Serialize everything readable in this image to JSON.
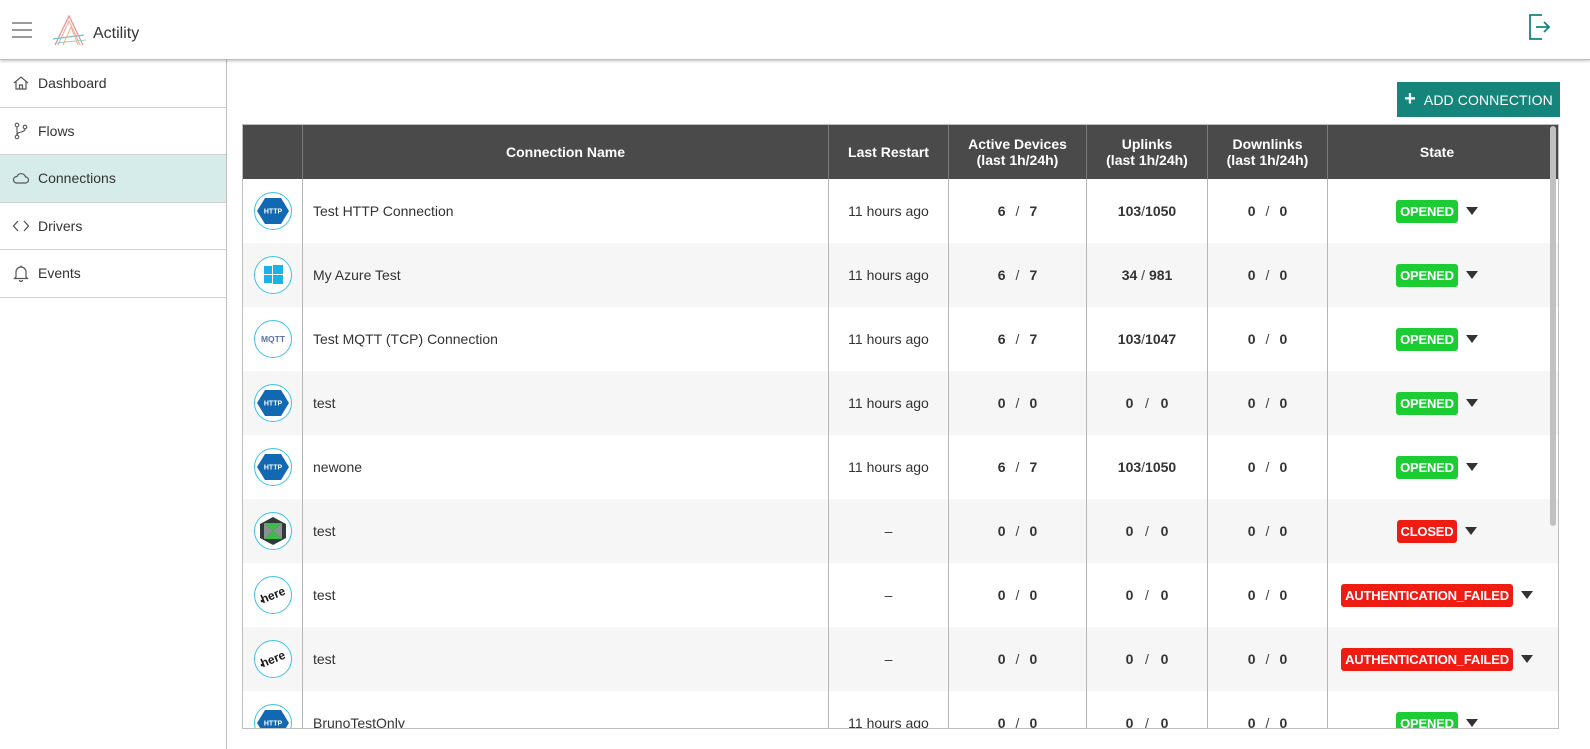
{
  "app": {
    "brand": "Actility"
  },
  "sidebar": {
    "items": [
      {
        "label": "Dashboard",
        "icon": "home-icon",
        "active": false
      },
      {
        "label": "Flows",
        "icon": "branch-icon",
        "active": false
      },
      {
        "label": "Connections",
        "icon": "cloud-icon",
        "active": true
      },
      {
        "label": "Drivers",
        "icon": "code-icon",
        "active": false
      },
      {
        "label": "Events",
        "icon": "bell-icon",
        "active": false
      }
    ]
  },
  "toolbar": {
    "add_label": "ADD CONNECTION"
  },
  "table": {
    "headers": {
      "name": "Connection Name",
      "restart": "Last Restart",
      "active_1": "Active Devices",
      "active_2": "(last 1h/24h)",
      "uplinks_1": "Uplinks",
      "uplinks_2": "(last 1h/24h)",
      "downlinks_1": "Downlinks",
      "downlinks_2": "(last 1h/24h)",
      "state": "State"
    },
    "rows": [
      {
        "icon": "http-icon",
        "name": "Test HTTP Connection",
        "restart": "11 hours ago",
        "active_1h": "6",
        "active_24h": "7",
        "up_1h": "103",
        "up_24h": "1050",
        "up_sep": "/",
        "down_1h": "0",
        "down_24h": "0",
        "state": "OPENED",
        "state_color": "#1bcd33"
      },
      {
        "icon": "windows-icon",
        "name": "My Azure Test",
        "restart": "11 hours ago",
        "active_1h": "6",
        "active_24h": "7",
        "up_1h": "34",
        "up_24h": "981",
        "up_sep": " / ",
        "down_1h": "0",
        "down_24h": "0",
        "state": "OPENED",
        "state_color": "#1bcd33"
      },
      {
        "icon": "mqtt-icon",
        "name": "Test MQTT (TCP) Connection",
        "restart": "11 hours ago",
        "active_1h": "6",
        "active_24h": "7",
        "up_1h": "103",
        "up_24h": "1047",
        "up_sep": "/",
        "down_1h": "0",
        "down_24h": "0",
        "state": "OPENED",
        "state_color": "#1bcd33"
      },
      {
        "icon": "http-icon",
        "name": "test",
        "restart": "11 hours ago",
        "active_1h": "0",
        "active_24h": "0",
        "up_1h": "0",
        "up_24h": "0",
        "up_sep": "   /   ",
        "down_1h": "0",
        "down_24h": "0",
        "state": "OPENED",
        "state_color": "#1bcd33"
      },
      {
        "icon": "http-icon",
        "name": "newone",
        "restart": "11 hours ago",
        "active_1h": "6",
        "active_24h": "7",
        "up_1h": "103",
        "up_24h": "1050",
        "up_sep": "/",
        "down_1h": "0",
        "down_24h": "0",
        "state": "OPENED",
        "state_color": "#1bcd33"
      },
      {
        "icon": "cross-cube-icon",
        "name": "test",
        "restart": "–",
        "active_1h": "0",
        "active_24h": "0",
        "up_1h": "0",
        "up_24h": "0",
        "up_sep": "   /   ",
        "down_1h": "0",
        "down_24h": "0",
        "state": "CLOSED",
        "state_color": "#ee1c12"
      },
      {
        "icon": "here-icon",
        "name": "test",
        "restart": "–",
        "active_1h": "0",
        "active_24h": "0",
        "up_1h": "0",
        "up_24h": "0",
        "up_sep": "   /   ",
        "down_1h": "0",
        "down_24h": "0",
        "state": "AUTHENTICATION_FAILED",
        "state_color": "#ee1c12"
      },
      {
        "icon": "here-icon",
        "name": "test",
        "restart": "–",
        "active_1h": "0",
        "active_24h": "0",
        "up_1h": "0",
        "up_24h": "0",
        "up_sep": "   /   ",
        "down_1h": "0",
        "down_24h": "0",
        "state": "AUTHENTICATION_FAILED",
        "state_color": "#ee1c12"
      },
      {
        "icon": "http-icon",
        "name": "BrunoTestOnly",
        "restart": "11 hours ago",
        "active_1h": "0",
        "active_24h": "0",
        "up_1h": "0",
        "up_24h": "0",
        "up_sep": "   /   ",
        "down_1h": "0",
        "down_24h": "0",
        "state": "OPENED",
        "state_color": "#1bcd33"
      }
    ]
  }
}
